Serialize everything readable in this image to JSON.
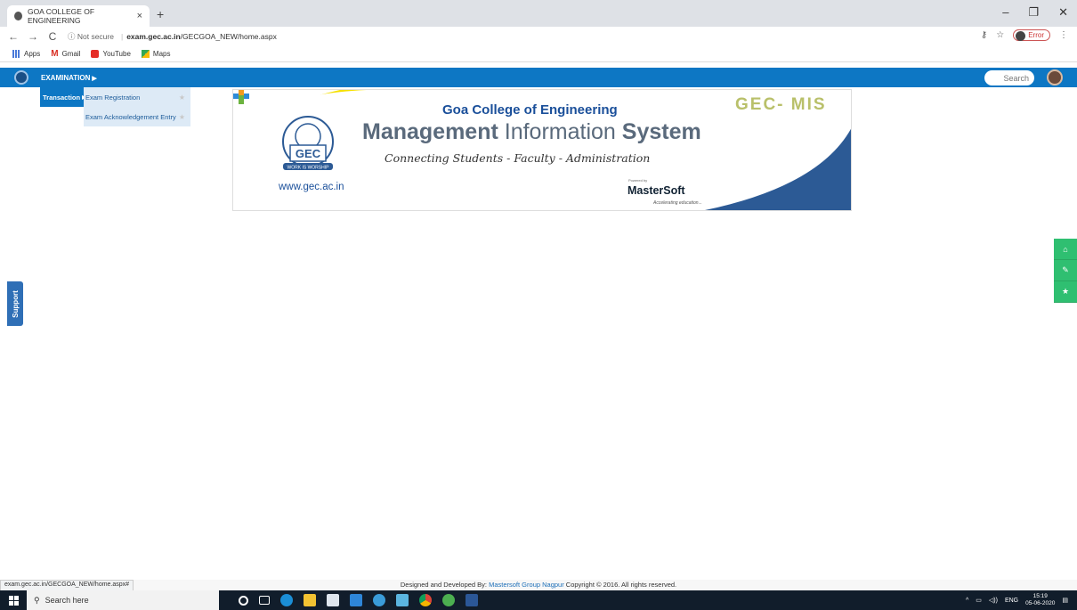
{
  "browser": {
    "tab_title": "GOA COLLEGE OF ENGINEERING",
    "tab_close": "×",
    "new_tab": "+",
    "window_controls": [
      "–",
      "❐",
      "✕"
    ],
    "nav": {
      "back": "←",
      "forward": "→",
      "reload": "C"
    },
    "security_label": "ⓘ Not secure",
    "url_host": "exam.gec.ac.in",
    "url_path": "/GECGOA_NEW/home.aspx",
    "error_label": "Error",
    "bookmarks": [
      "Apps",
      "Gmail",
      "YouTube",
      "Maps"
    ]
  },
  "app": {
    "menu_top": "EXAMINATION",
    "submenu_group": "Transaction",
    "submenu_items": [
      "Exam Registration",
      "Exam Acknowledgement Entry"
    ],
    "search_label": "Search",
    "support_label": "Support"
  },
  "banner": {
    "college": "Goa College of Engineering",
    "mis_a": "Management",
    "mis_b": " Information ",
    "mis_c": "System",
    "tagline": "Connecting Students - Faculty - Administration",
    "website": "www.gec.ac.in",
    "brand": "GEC- MIS",
    "powered_by": "Powered by",
    "vendor": "MasterSoft",
    "vendor_tag": "Accelerating education...",
    "logo_motto": "WORK IS WORSHIP",
    "logo_text": "GEC"
  },
  "footer": {
    "prefix": "Designed and Developed By: ",
    "link": "Mastersoft Group Nagpur",
    "suffix": " Copyright © 2016. All rights reserved."
  },
  "status_url": "exam.gec.ac.in/GECGOA_NEW/home.aspx#",
  "taskbar": {
    "search_placeholder": "Search here",
    "language": "ENG",
    "time": "15:19",
    "date": "05-06-2020"
  },
  "colors": {
    "app_bar": "#0d77c4",
    "side_buttons": "#2fbf71",
    "support": "#2f6fb6"
  }
}
